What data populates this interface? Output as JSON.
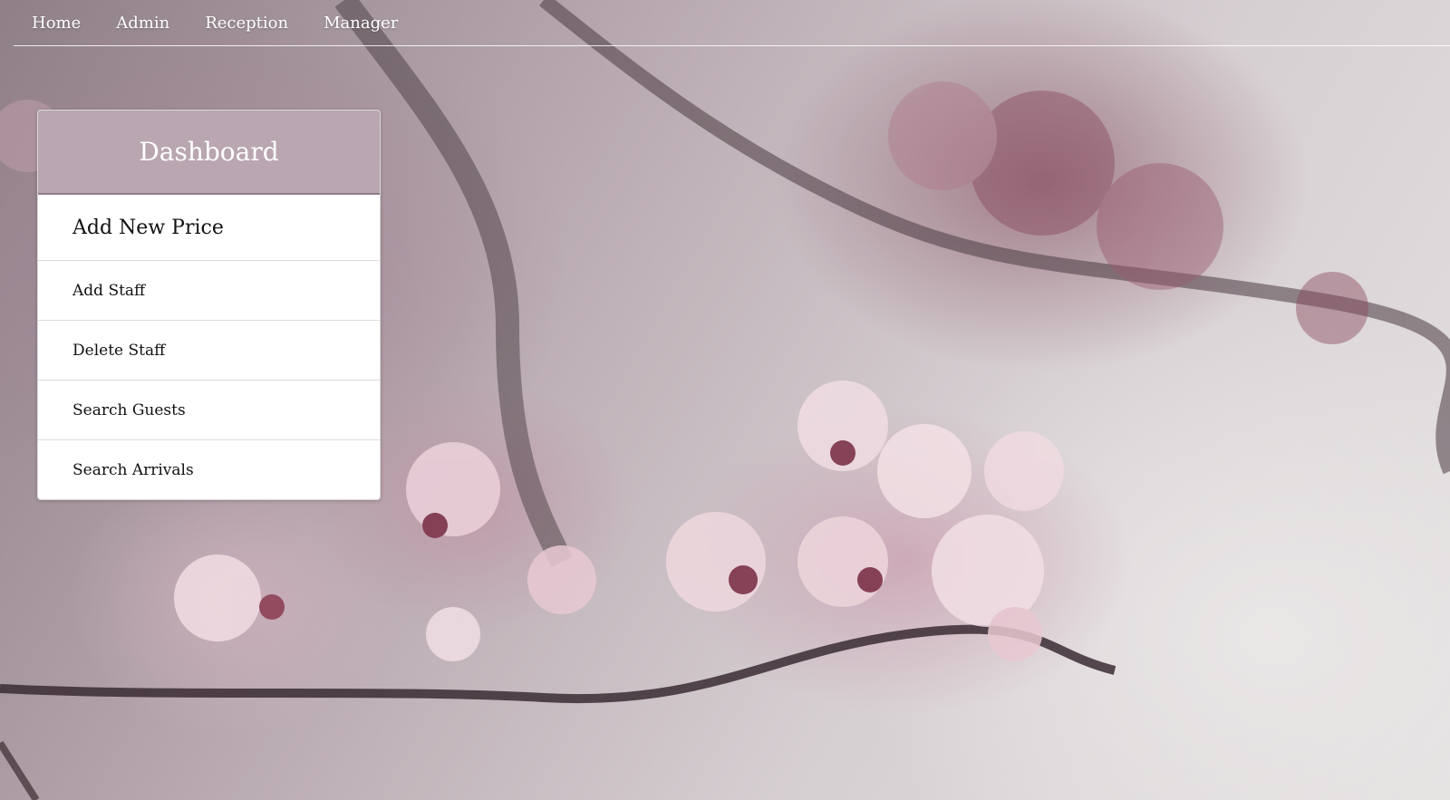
{
  "nav": {
    "items": [
      {
        "label": "Home"
      },
      {
        "label": "Admin"
      },
      {
        "label": "Reception"
      },
      {
        "label": "Manager"
      }
    ]
  },
  "dashboard": {
    "title": "Dashboard",
    "items": [
      {
        "label": "Add New Price"
      },
      {
        "label": "Add Staff"
      },
      {
        "label": "Delete Staff"
      },
      {
        "label": "Search Guests"
      },
      {
        "label": "Search Arrivals"
      }
    ]
  },
  "colors": {
    "panel_heading": "#b9a6b1",
    "nav_text": "#ffffff",
    "background_tone": "#d8d0d4"
  }
}
